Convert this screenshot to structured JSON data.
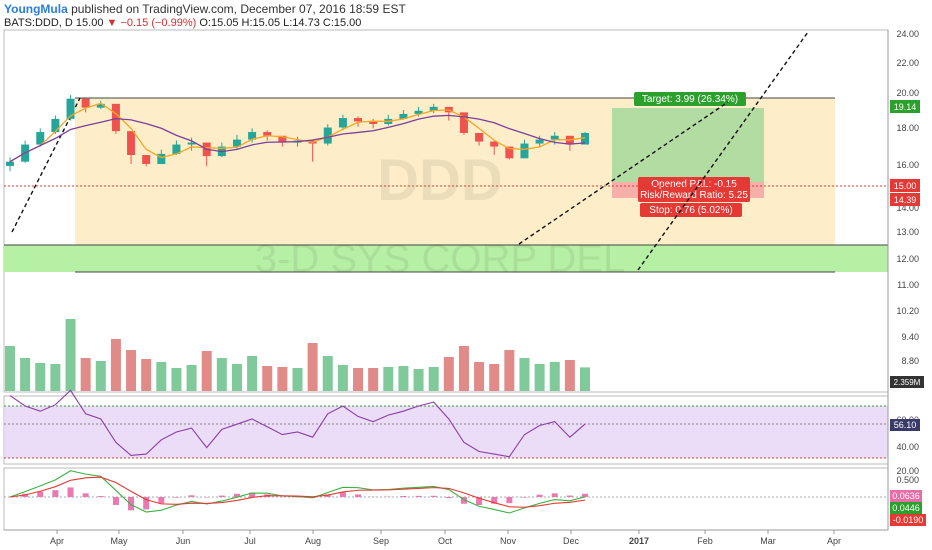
{
  "header": {
    "author": "YoungMula",
    "published_text": "published on TradingView.com, December 07, 2016 18:59 EST"
  },
  "symbol_line": {
    "symbol": "BATS:DDD, D",
    "price": "15.00",
    "change": "▼ −0.15 (−0.99%)",
    "ohlc": "O:15.05 H:15.05 L:14.73 C:15.00"
  },
  "colors": {
    "up": "#26a69a",
    "down": "#ef5350",
    "ma_fast": "#f5a623",
    "ma_slow": "#7b3f9e",
    "band_yellow": "#fdeec9",
    "band_green": "#b6f0a4",
    "target_green": "#a5d89a",
    "stop_red": "#f4a3a3",
    "rsi_fill": "#e6d3f5",
    "rsi_line": "#8a3ea5",
    "macd_green": "#3cb043",
    "macd_red": "#e53935",
    "macd_hist": "#e87ab1"
  },
  "watermark": {
    "symbol": "DDD",
    "name": "3-D SYS CORP DEL"
  },
  "price_axis": {
    "ticks": [
      "24.00",
      "22.00",
      "20.00",
      "18.00",
      "16.00",
      "14.00",
      "13.00",
      "12.00",
      "11.00",
      "10.20",
      "9.40",
      "8.80"
    ],
    "last_price_label": "15.00",
    "entry_label": "14.39",
    "target_label": "19.14"
  },
  "time_axis": {
    "labels": [
      "Apr",
      "May",
      "Jun",
      "Jul",
      "Aug",
      "Sep",
      "Oct",
      "Nov",
      "Dec",
      "2017",
      "Feb",
      "Mar",
      "Apr"
    ]
  },
  "position": {
    "target_text": "Target: 3.99 (26.34%)",
    "pnl_text": "Opened P&L: -0.15",
    "rr_text": "Risk/Reward Ratio: 5.25",
    "stop_text": "Stop: 0.76 (5.02%)"
  },
  "volume_panel": {
    "axis_label": "2.359M"
  },
  "rsi_panel": {
    "ticks": [
      "60.00",
      "40.00",
      "20.00"
    ],
    "current_label": "56.10"
  },
  "macd_panel": {
    "ticks": [
      "0.500",
      "0.000",
      "-0.500"
    ],
    "label_hist": "0.0636",
    "label_macd": "0.0446",
    "label_signal": "-0.0190"
  },
  "chart_data": {
    "type": "candlestick",
    "price_scale": "log",
    "ylim": [
      8.6,
      25.0
    ],
    "dates": [
      "2016-03-14",
      "2016-03-21",
      "2016-03-28",
      "2016-04-04",
      "2016-04-11",
      "2016-04-18",
      "2016-04-25",
      "2016-05-02",
      "2016-05-09",
      "2016-05-16",
      "2016-05-23",
      "2016-05-31",
      "2016-06-06",
      "2016-06-13",
      "2016-06-20",
      "2016-06-27",
      "2016-07-05",
      "2016-07-11",
      "2016-07-18",
      "2016-07-25",
      "2016-08-01",
      "2016-08-08",
      "2016-08-15",
      "2016-08-22",
      "2016-08-29",
      "2016-09-06",
      "2016-09-12",
      "2016-09-19",
      "2016-09-26",
      "2016-10-03",
      "2016-10-10",
      "2016-10-17",
      "2016-10-24",
      "2016-10-31",
      "2016-11-07",
      "2016-11-14",
      "2016-11-21",
      "2016-11-28",
      "2016-12-05"
    ],
    "close": [
      12.2,
      13.8,
      15.1,
      16.6,
      19.2,
      18.0,
      18.5,
      15.2,
      12.8,
      12.0,
      12.9,
      13.8,
      14.0,
      12.7,
      13.6,
      14.3,
      15.1,
      14.7,
      14.0,
      14.2,
      13.9,
      15.6,
      16.7,
      16.3,
      16.0,
      16.6,
      17.2,
      17.6,
      18.1,
      17.4,
      15.0,
      14.1,
      13.6,
      12.5,
      13.9,
      14.3,
      14.7,
      13.8,
      15.0
    ],
    "high": [
      12.6,
      14.2,
      15.5,
      17.0,
      19.7,
      18.9,
      18.9,
      17.0,
      13.5,
      12.6,
      13.3,
      14.2,
      14.5,
      13.8,
      14.0,
      14.8,
      15.5,
      15.3,
      14.6,
      14.6,
      14.3,
      16.0,
      17.1,
      16.9,
      16.6,
      17.1,
      17.7,
      18.1,
      18.5,
      17.8,
      17.3,
      14.6,
      14.2,
      13.4,
      14.3,
      14.7,
      15.1,
      14.6,
      15.1
    ],
    "low": [
      11.4,
      12.1,
      13.6,
      14.9,
      16.4,
      17.4,
      17.8,
      14.9,
      12.0,
      11.8,
      12.0,
      12.8,
      13.2,
      11.8,
      12.6,
      13.4,
      14.0,
      14.2,
      13.6,
      13.6,
      12.2,
      13.7,
      15.4,
      15.7,
      15.5,
      15.8,
      16.5,
      16.9,
      17.3,
      16.4,
      14.8,
      13.7,
      12.8,
      12.4,
      12.7,
      13.6,
      13.8,
      13.2,
      14.7
    ],
    "volume_m": [
      4.5,
      3.3,
      2.8,
      2.7,
      7.2,
      3.3,
      3.0,
      5.2,
      4.1,
      3.2,
      2.9,
      2.3,
      2.6,
      4.0,
      3.3,
      2.7,
      3.5,
      2.5,
      2.4,
      2.3,
      4.8,
      3.5,
      2.6,
      2.3,
      2.3,
      2.4,
      2.5,
      2.2,
      2.4,
      3.4,
      4.5,
      2.9,
      2.7,
      4.1,
      3.3,
      2.7,
      2.9,
      3.1,
      2.36
    ],
    "rsi_levels": [
      70,
      30
    ],
    "rsi": [
      78,
      70,
      66,
      71,
      82,
      64,
      60,
      42,
      32,
      33,
      44,
      50,
      53,
      38,
      52,
      56,
      60,
      54,
      48,
      50,
      46,
      64,
      70,
      62,
      58,
      63,
      66,
      70,
      73,
      60,
      42,
      35,
      33,
      31,
      48,
      55,
      58,
      46,
      56.1
    ]
  }
}
